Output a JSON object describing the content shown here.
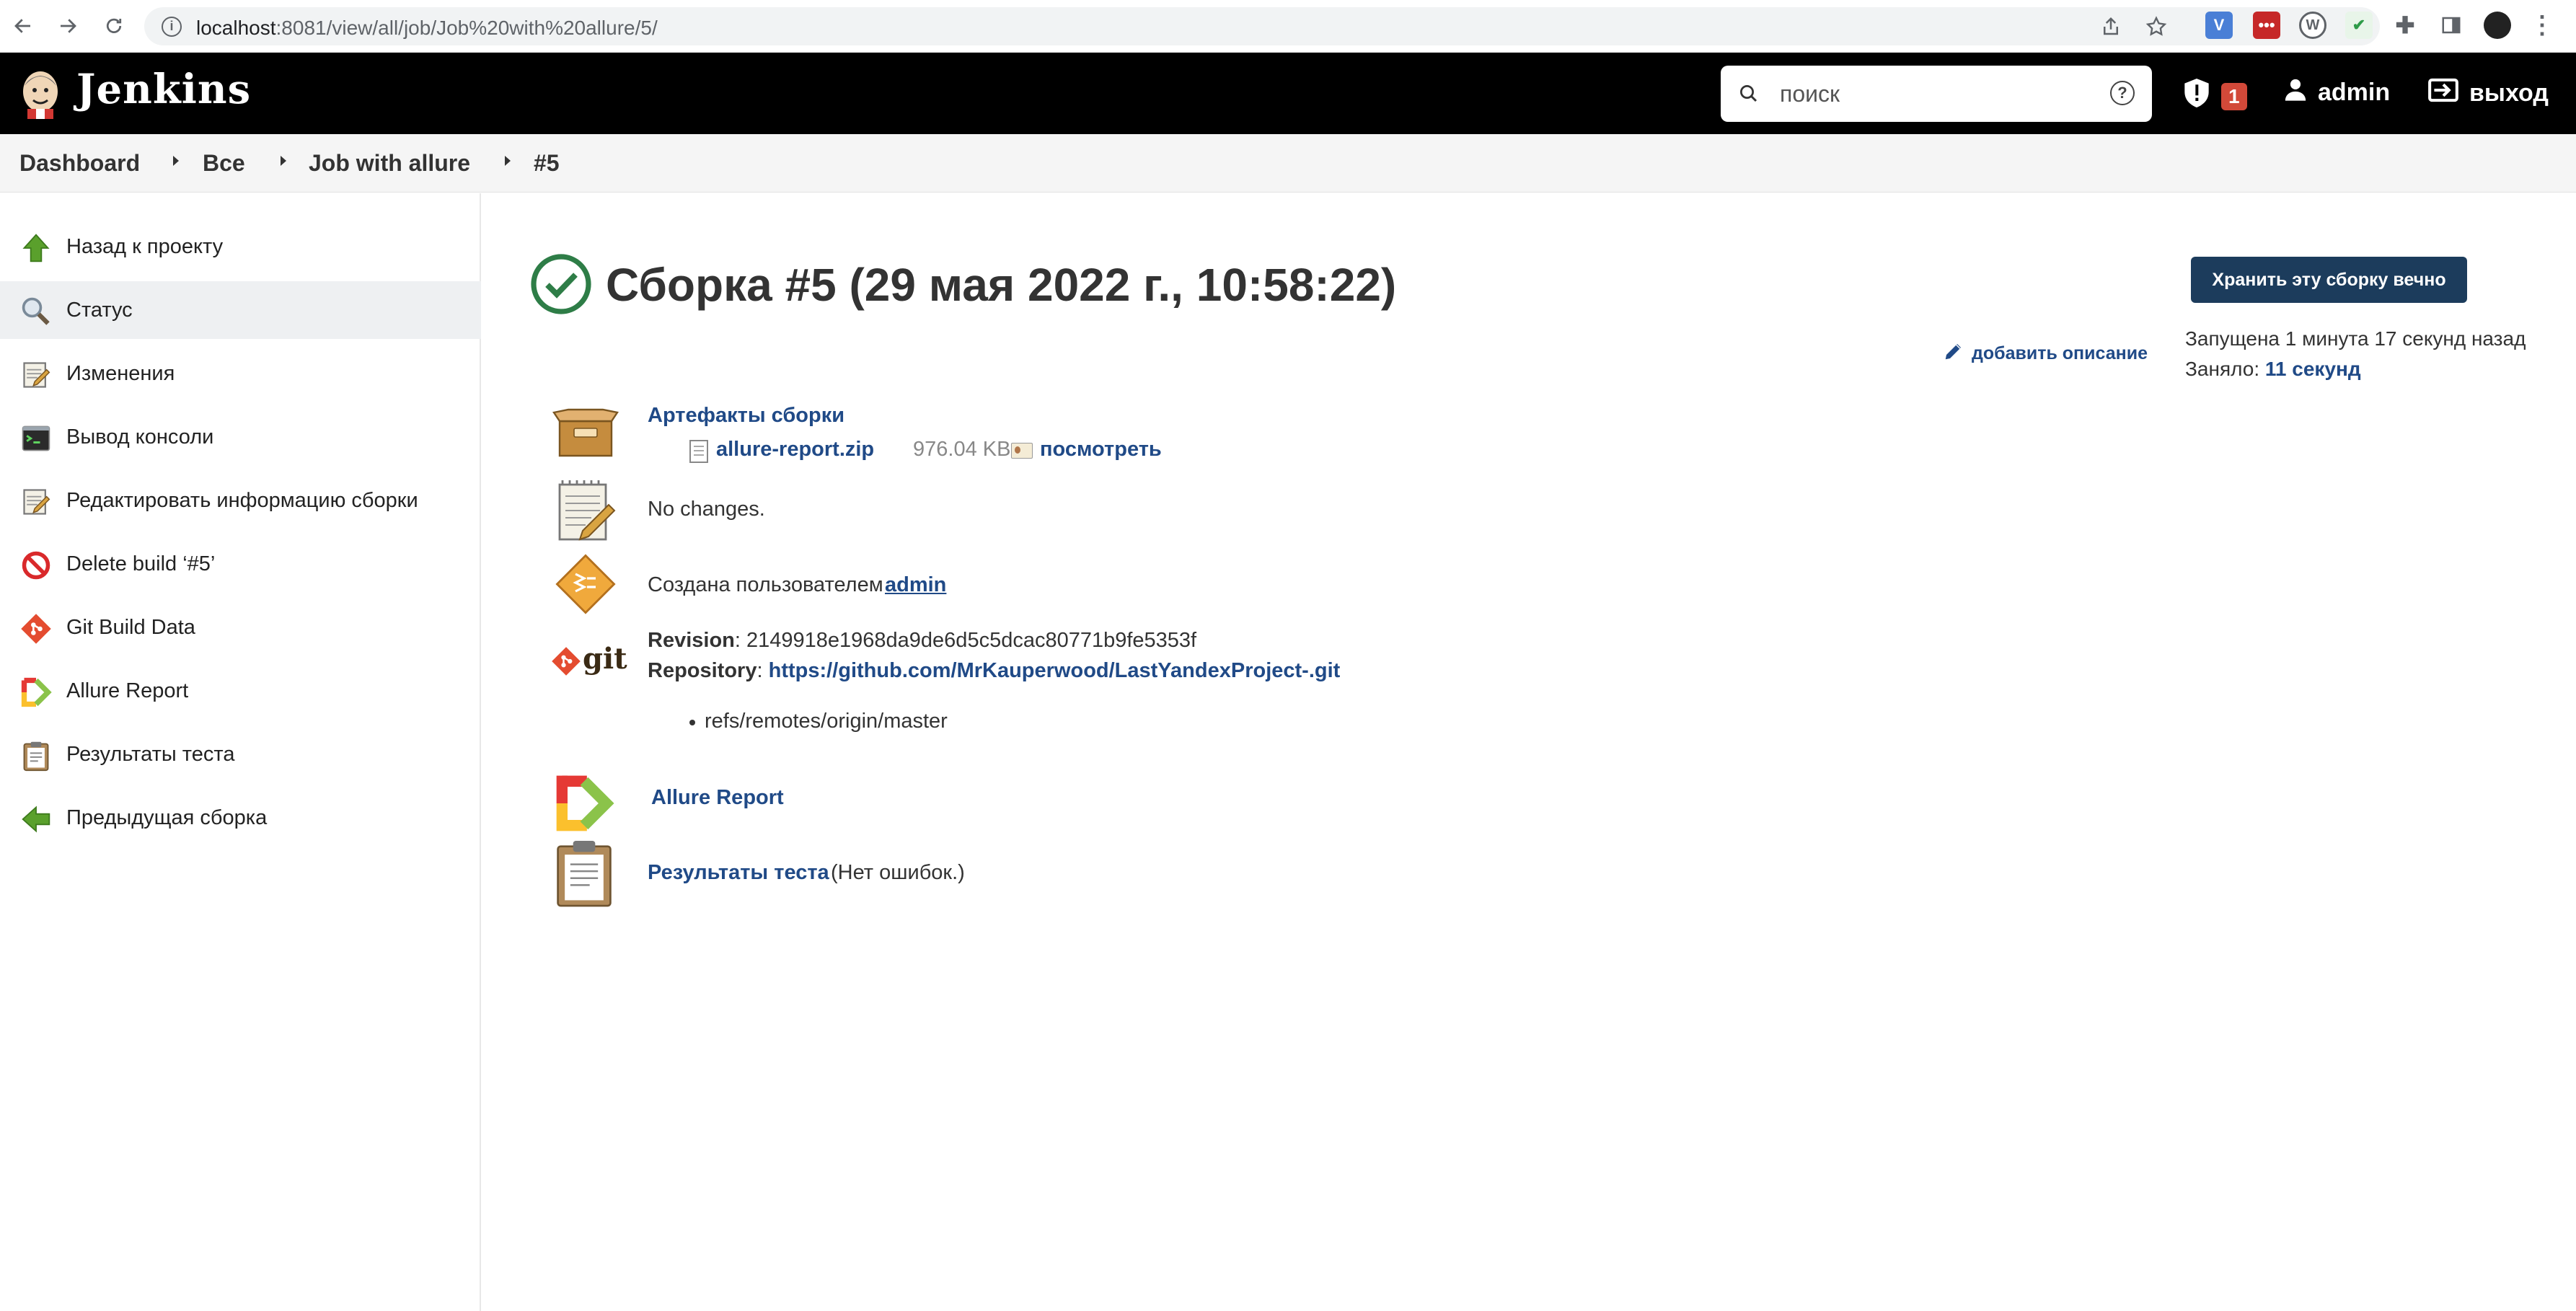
{
  "browser": {
    "url_host": "localhost",
    "url_path": ":8081/view/all/job/Job%20with%20allure/5/"
  },
  "header": {
    "brand": "Jenkins",
    "search_placeholder": "поиск",
    "security_count": "1",
    "user": "admin",
    "logout": "выход"
  },
  "breadcrumbs": [
    "Dashboard",
    "Все",
    "Job with allure",
    "#5"
  ],
  "sidebar": {
    "items": [
      {
        "label": "Назад к проекту",
        "icon": "up-arrow-icon"
      },
      {
        "label": "Статус",
        "icon": "magnifier-icon"
      },
      {
        "label": "Изменения",
        "icon": "notepad-icon"
      },
      {
        "label": "Вывод консоли",
        "icon": "terminal-icon"
      },
      {
        "label": "Редактировать информацию сборки",
        "icon": "notepad-icon"
      },
      {
        "label": "Delete build ‘#5’",
        "icon": "no-entry-icon"
      },
      {
        "label": "Git Build Data",
        "icon": "git-icon"
      },
      {
        "label": "Allure Report",
        "icon": "allure-icon"
      },
      {
        "label": "Результаты теста",
        "icon": "clipboard-icon"
      },
      {
        "label": "Предыдущая сборка",
        "icon": "left-arrow-icon"
      }
    ]
  },
  "main": {
    "title": "Сборка #5 (29 мая 2022 г., 10:58:22)",
    "keep_button": "Хранить эту сборку вечно",
    "started": "Запущена 1 минута 17 секунд назад",
    "took_label": "Заняло:",
    "took_value": "11 секунд",
    "add_description": "добавить описание",
    "artifacts": {
      "title": "Артефакты сборки",
      "file": "allure-report.zip",
      "size": "976.04 KB",
      "view": "посмотреть"
    },
    "changes": "No changes.",
    "cause_prefix": "Создана пользователем",
    "cause_user": "admin",
    "git": {
      "revision_label": "Revision",
      "revision": "2149918e1968da9de6d5c5dcac80771b9fe5353f",
      "repository_label": "Repository",
      "repository": "https://github.com/MrKauperwood/LastYandexProject-.git",
      "branch": "refs/remotes/origin/master",
      "logo_text": "git"
    },
    "allure_link": "Allure Report",
    "test_results_link": "Результаты теста",
    "test_results_status": "(Нет ошибок.)"
  },
  "colors": {
    "link": "#204a87",
    "header_bg": "#000000",
    "keep_button_bg": "#1c3c5c",
    "success": "#2e7d47",
    "badge": "#d24939"
  }
}
